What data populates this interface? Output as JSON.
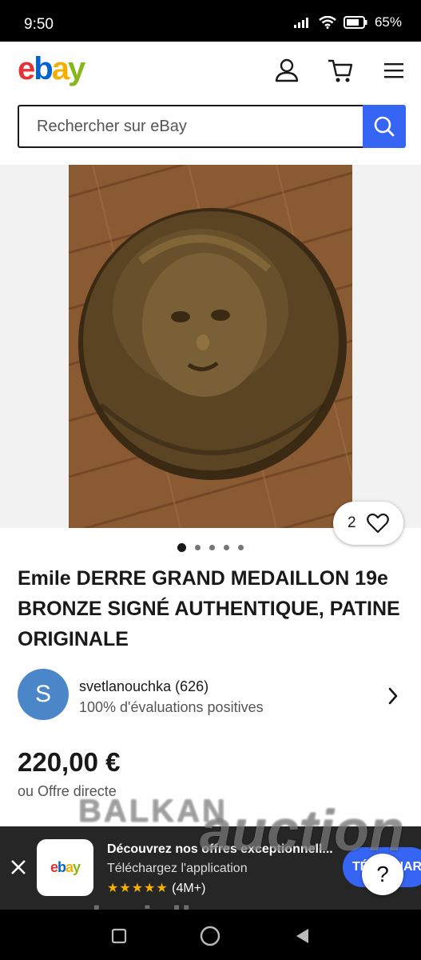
{
  "status_bar": {
    "time": "9:50",
    "battery": "65%"
  },
  "header": {
    "logo": [
      "e",
      "b",
      "a",
      "y"
    ]
  },
  "search": {
    "placeholder": "Rechercher sur eBay"
  },
  "gallery": {
    "watch_count": "2",
    "image_count": 5,
    "active_index": 1
  },
  "listing": {
    "title": "Emile DERRE GRAND MEDAILLON 19e BRONZE SIGNÉ AUTHENTIQUE, PATINE ORIGINALE",
    "price": "220,00 €",
    "offer": "ou Offre directe"
  },
  "seller": {
    "initial": "S",
    "name": "svetlanouchka (626)",
    "rating": "100% d'évaluations positives"
  },
  "app_banner": {
    "line1": "Découvrez nos offres exceptionnell...",
    "line2": "Téléchargez l'application",
    "stars": "★★★★★",
    "count": "(4M+)",
    "button": "TÉLÉCHARGER"
  },
  "help": {
    "label": "?"
  },
  "watermark": {
    "line1": "BALKAN",
    "line2": "auction",
    "line3": "daniellazarov"
  },
  "colors": {
    "ebay_blue": "#3665f3",
    "banner_bg": "#262626"
  }
}
